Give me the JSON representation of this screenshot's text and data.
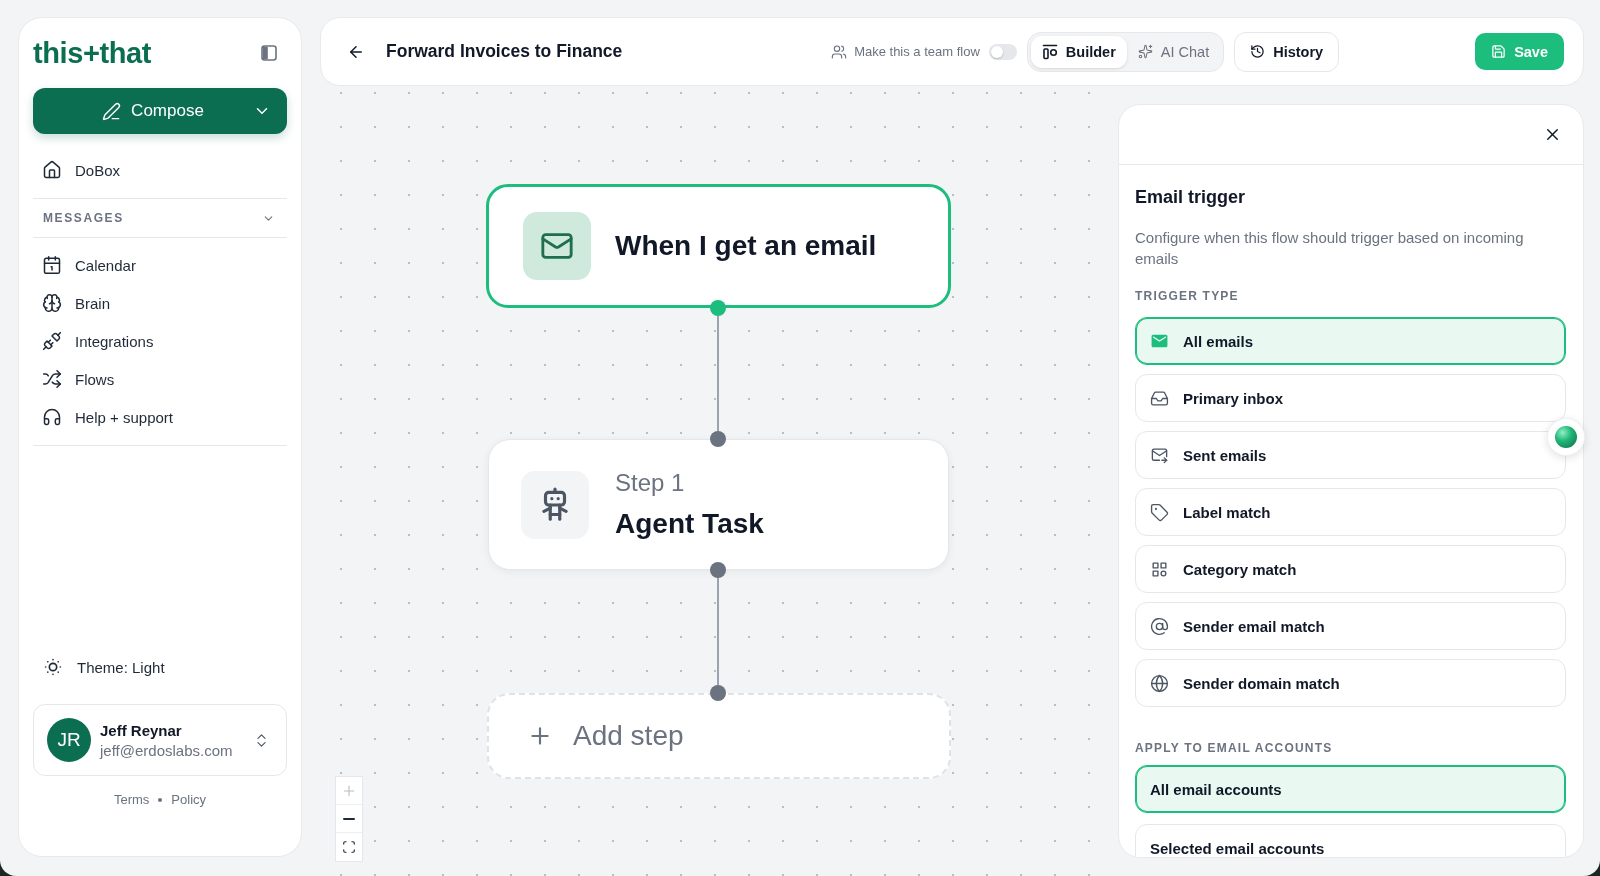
{
  "sidebar": {
    "logo": "this+that",
    "compose_button": "Compose",
    "home_items": [
      "DoBox"
    ],
    "section_title": "MESSAGES",
    "nav_items": [
      "Calendar",
      "Brain",
      "Integrations",
      "Flows",
      "Help + support"
    ],
    "theme_button": "Theme: Light",
    "user": {
      "initials": "JR",
      "name": "Jeff Reynar",
      "email": "jeff@erdoslabs.com"
    },
    "footer_links": [
      "Terms",
      "Policy"
    ]
  },
  "top_bar": {
    "title": "Forward Invoices to Finance",
    "team_flow": {
      "label": "Make this a team flow",
      "on": false
    },
    "view_tabs": [
      {
        "label": "Builder",
        "selected": true
      },
      {
        "label": "AI Chat",
        "selected": false
      }
    ],
    "history_button": "History",
    "save_button": "Save"
  },
  "canvas": {
    "nodes": [
      {
        "kind": "trigger",
        "title": "When I get an email",
        "selected": true
      },
      {
        "kind": "step",
        "label": "Step 1",
        "title": "Agent Task",
        "selected": false
      },
      {
        "kind": "add",
        "label": "Add step"
      }
    ],
    "zoom_in": {
      "disabled": true
    }
  },
  "panel": {
    "title": "Email trigger",
    "description": "Configure when this flow should trigger based on incoming emails",
    "trigger_type_heading": "TRIGGER TYPE",
    "trigger_types": [
      {
        "label": "All emails",
        "selected": true
      },
      {
        "label": "Primary inbox",
        "selected": false
      },
      {
        "label": "Sent emails",
        "selected": false
      },
      {
        "label": "Label match",
        "selected": false
      },
      {
        "label": "Category match",
        "selected": false
      },
      {
        "label": "Sender email match",
        "selected": false
      },
      {
        "label": "Sender domain match",
        "selected": false
      }
    ],
    "accounts_heading": "APPLY TO EMAIL ACCOUNTS",
    "accounts": [
      {
        "label": "All email accounts",
        "selected": true
      },
      {
        "label": "Selected email accounts",
        "selected": false
      }
    ]
  }
}
